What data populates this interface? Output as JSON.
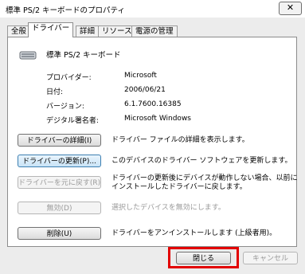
{
  "window": {
    "title": "標準 PS/2 キーボードのプロパティ",
    "close_glyph": "✕"
  },
  "tabs": [
    {
      "label": "全般"
    },
    {
      "label": "ドライバー"
    },
    {
      "label": "詳細"
    },
    {
      "label": "リソース"
    },
    {
      "label": "電源の管理"
    }
  ],
  "device": {
    "name": "標準 PS/2 キーボード",
    "icon": "keyboard-icon"
  },
  "info": [
    {
      "label": "プロバイダー:",
      "value": "Microsoft"
    },
    {
      "label": "日付:",
      "value": "2006/06/21"
    },
    {
      "label": "バージョン:",
      "value": "6.1.7600.16385"
    },
    {
      "label": "デジタル署名者:",
      "value": "Microsoft Windows"
    }
  ],
  "actions": [
    {
      "button": "ドライバーの詳細(I)",
      "desc_lines": [
        "ドライバー ファイルの詳細を表示します。"
      ]
    },
    {
      "button": "ドライバーの更新(P)...",
      "desc_lines": [
        "このデバイスのドライバー ソフトウェアを更新します。"
      ]
    },
    {
      "button": "ドライバーを元に戻す(R)",
      "desc_lines": [
        "ドライバーの更新後にデバイスが動作しない場合、以前に",
        "インストールしたドライバーに戻します。"
      ]
    },
    {
      "button": "無効(D)",
      "desc_lines": [
        "選択したデバイスを無効にします。"
      ]
    },
    {
      "button": "削除(U)",
      "desc_lines": [
        "ドライバーをアンインストールします (上級者用)。"
      ]
    }
  ],
  "footer": {
    "close_label": "閉じる",
    "cancel_label": "キャンセル"
  },
  "colors": {
    "highlight": "#e30000",
    "focus": "#3c7fb1"
  }
}
